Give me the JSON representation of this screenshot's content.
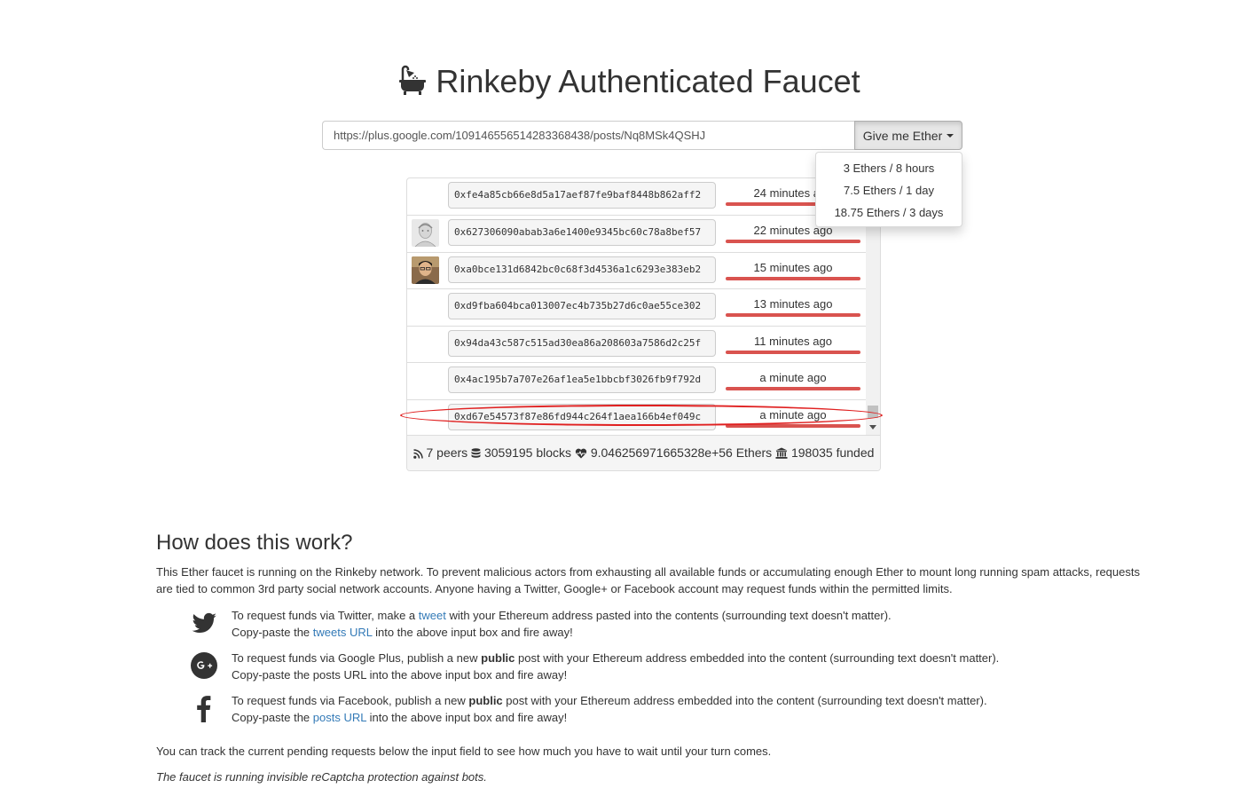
{
  "page": {
    "title": "Rinkeby Authenticated Faucet",
    "title_icon": "bath-icon"
  },
  "request": {
    "url_value": "https://plus.google.com/109146556514283368438/posts/Nq8MSk4QSHJ",
    "button_label": "Give me Ether",
    "options": [
      "3 Ethers / 8 hours",
      "7.5 Ethers / 1 day",
      "18.75 Ethers / 3 days"
    ]
  },
  "queue": [
    {
      "address": "0xfe4a85cb66e8d5a17aef87fe9baf8448b862aff2",
      "time": "24 minutes ago",
      "avatar": "none"
    },
    {
      "address": "0x627306090abab3a6e1400e9345bc60c78a8bef57",
      "time": "22 minutes ago",
      "avatar": "sketch-face"
    },
    {
      "address": "0xa0bce131d6842bc0c68f3d4536a1c6293e383eb2",
      "time": "15 minutes ago",
      "avatar": "photo-face"
    },
    {
      "address": "0xd9fba604bca013007ec4b735b27d6c0ae55ce302",
      "time": "13 minutes ago",
      "avatar": "none"
    },
    {
      "address": "0x94da43c587c515ad30ea86a208603a7586d2c25f",
      "time": "11 minutes ago",
      "avatar": "none"
    },
    {
      "address": "0x4ac195b7a707e26af1ea5e1bbcbf3026fb9f792d",
      "time": "a minute ago",
      "avatar": "none"
    },
    {
      "address": "0xd67e54573f87e86fd944c264f1aea166b4ef049c",
      "time": "a minute ago",
      "avatar": "none"
    }
  ],
  "stats": {
    "peers": "7 peers",
    "blocks": "3059195 blocks",
    "ethers": "9.046256971665328e+56 Ethers",
    "funded": "198035 funded"
  },
  "how": {
    "heading": "How does this work?",
    "intro": "This Ether faucet is running on the Rinkeby network. To prevent malicious actors from exhausting all available funds or accumulating enough Ether to mount long running spam attacks, requests are tied to common 3rd party social network accounts. Anyone having a Twitter, Google+ or Facebook account may request funds within the permitted limits.",
    "twitter": {
      "l1_a": "To request funds via Twitter, make a ",
      "l1_link": "tweet",
      "l1_b": " with your Ethereum address pasted into the contents (surrounding text doesn't matter).",
      "l2_a": "Copy-paste the ",
      "l2_link": "tweets URL",
      "l2_b": " into the above input box and fire away!"
    },
    "gplus": {
      "l1_a": "To request funds via Google Plus, publish a new ",
      "l1_bold": "public",
      "l1_b": " post with your Ethereum address embedded into the content (surrounding text doesn't matter).",
      "l2": "Copy-paste the posts URL into the above input box and fire away!"
    },
    "facebook": {
      "l1_a": "To request funds via Facebook, publish a new ",
      "l1_bold": "public",
      "l1_b": " post with your Ethereum address embedded into the content (surrounding text doesn't matter).",
      "l2_a": "Copy-paste the ",
      "l2_link": "posts URL",
      "l2_b": " into the above input box and fire away!"
    },
    "track": "You can track the current pending requests below the input field to see how much you have to wait until your turn comes.",
    "recaptcha": "The faucet is running invisible reCaptcha protection against bots."
  },
  "colors": {
    "bar": "#d9534f",
    "link": "#337ab7",
    "annotation": "#e02020"
  }
}
